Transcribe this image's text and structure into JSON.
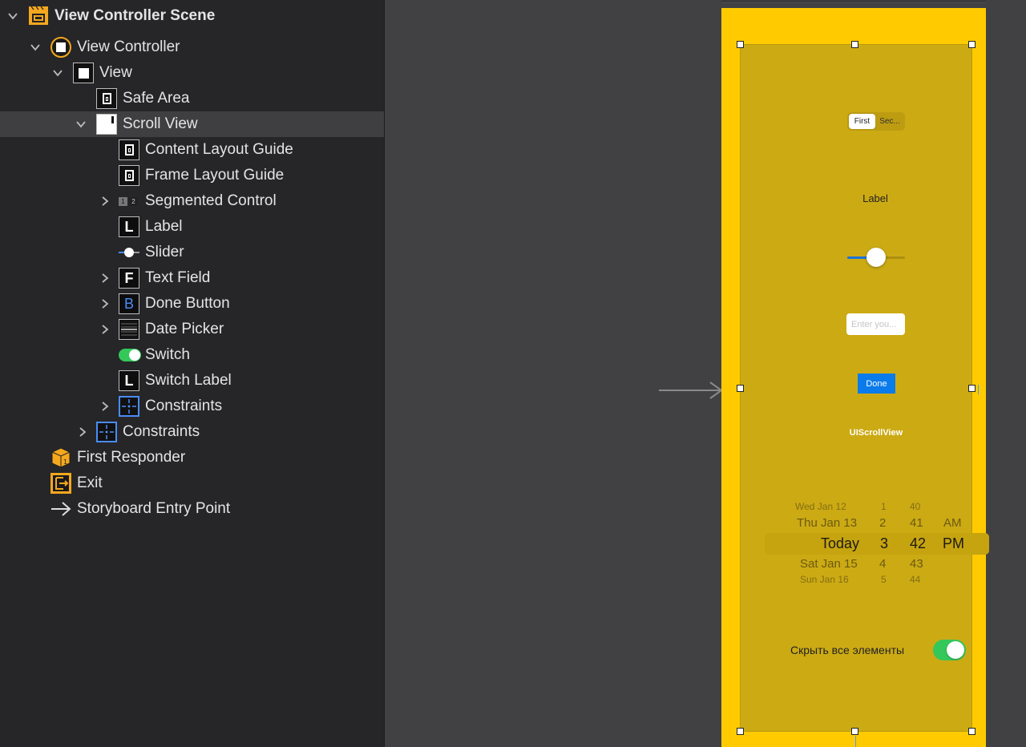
{
  "outline": {
    "items": [
      {
        "label": "View Controller Scene",
        "icon": "scene-icon",
        "expanded": true
      },
      {
        "label": "View Controller",
        "icon": "view-controller-icon",
        "expanded": true
      },
      {
        "label": "View",
        "icon": "view-icon",
        "expanded": true
      },
      {
        "label": "Safe Area",
        "icon": "layout-guide-icon"
      },
      {
        "label": "Scroll View",
        "icon": "scroll-view-icon",
        "expanded": true,
        "selected": true
      },
      {
        "label": "Content Layout Guide",
        "icon": "layout-guide-icon"
      },
      {
        "label": "Frame Layout Guide",
        "icon": "layout-guide-icon"
      },
      {
        "label": "Segmented Control",
        "icon": "segmented-control-icon",
        "expanded": false
      },
      {
        "label": "Label",
        "icon": "label-icon"
      },
      {
        "label": "Slider",
        "icon": "slider-icon"
      },
      {
        "label": "Text Field",
        "icon": "text-field-icon",
        "expanded": false
      },
      {
        "label": "Done Button",
        "icon": "button-icon",
        "expanded": false
      },
      {
        "label": "Date Picker",
        "icon": "date-picker-icon",
        "expanded": false
      },
      {
        "label": "Switch",
        "icon": "switch-icon"
      },
      {
        "label": "Switch Label",
        "icon": "label-icon"
      },
      {
        "label": "Constraints",
        "icon": "constraints-icon",
        "expanded": false
      },
      {
        "label": "Constraints",
        "icon": "constraints-icon",
        "expanded": false
      },
      {
        "label": "First Responder",
        "icon": "first-responder-icon"
      },
      {
        "label": "Exit",
        "icon": "exit-icon"
      },
      {
        "label": "Storyboard Entry Point",
        "icon": "entry-arrow-icon"
      }
    ],
    "icon_glyphs": {
      "label": "L",
      "text_field": "F",
      "button": "B",
      "segmented_1": "1",
      "segmented_2": "2"
    }
  },
  "canvas": {
    "segmented": {
      "first": "First",
      "second": "Sec..."
    },
    "label_text": "Label",
    "slider_value": 0.5,
    "text_field_placeholder": "Enter you...",
    "done_button": "Done",
    "scroll_view_name": "UIScrollView",
    "date_picker": {
      "days": [
        "Wed Jan 12",
        "Thu Jan 13",
        "Today",
        "Sat Jan 15",
        "Sun Jan 16"
      ],
      "hours": [
        "1",
        "2",
        "3",
        "4",
        "5"
      ],
      "minutes": [
        "40",
        "41",
        "42",
        "43",
        "44"
      ],
      "ampm": [
        "AM",
        "PM"
      ]
    },
    "switch_label": "Скрыть все элементы",
    "switch_on": true,
    "colors": {
      "device_background": "#ffcb00",
      "scroll_view": "#ccaa14",
      "tint": "#0a7bea",
      "switch_on": "#34c759"
    }
  }
}
